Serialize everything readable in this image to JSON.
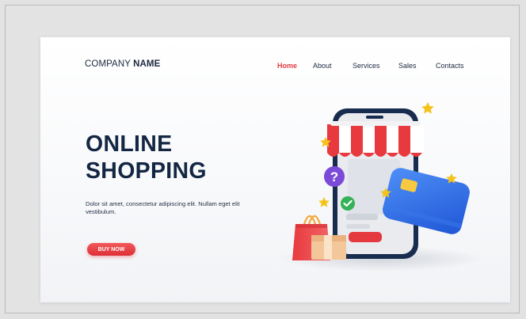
{
  "header": {
    "brand_prefix": "COMPANY",
    "brand_bold": "NAME",
    "nav": [
      {
        "label": "Home",
        "active": true
      },
      {
        "label": "About",
        "active": false
      },
      {
        "label": "Services",
        "active": false
      },
      {
        "label": "Sales",
        "active": false
      },
      {
        "label": "Contacts",
        "active": false
      }
    ]
  },
  "hero": {
    "title_line1": "ONLINE",
    "title_line2": "SHOPPING",
    "text": "Dolor sit amet, consectetur adipiscing elit. Nullam eget elit vestibulum.",
    "cta_label": "BUY NOW"
  },
  "illustration": {
    "icons": [
      "smartphone-icon",
      "shop-awning-icon",
      "question-mark-icon",
      "check-badge-icon",
      "credit-card-icon",
      "shopping-bag-icon",
      "parcel-box-icon",
      "star-icon"
    ],
    "question_glyph": "?"
  },
  "colors": {
    "accent": "#e53b3f",
    "title": "#132743",
    "card": "#2f6fe4",
    "star": "#f5c21b",
    "check": "#34b257",
    "question": "#7b4ad8"
  }
}
